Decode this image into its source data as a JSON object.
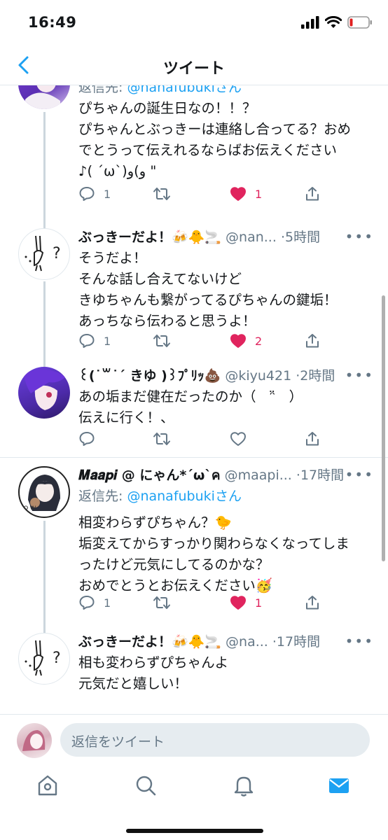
{
  "status_bar": {
    "time": "16:49"
  },
  "nav": {
    "title": "ツイート"
  },
  "tweets": [
    {
      "reply_prefix": "返信先: ",
      "reply_to": "@nanafubukiさん",
      "lines": [
        "ぴちゃんの誕生日なの！！？",
        "ぴちゃんとぶっきーは連絡し合ってる？おめ",
        "でとうって伝えれるならばお伝えください",
        "♪( ´ω`)و)و \""
      ],
      "replies": "1",
      "likes": "1",
      "liked": true
    },
    {
      "name": "ぶっきーだよ！🍻🐥🚬",
      "handle": "@nan...",
      "time": "·5時間",
      "lines": [
        "そうだよ！",
        "そんな話し合えてないけど",
        "きゆちゃんも繋がってるぴちゃんの鍵垢！",
        "あっちなら伝わると思うよ！"
      ],
      "replies": "1",
      "likes": "2",
      "liked": true
    },
    {
      "name": "꒰(˙꒳˙´ きゆ )꒱ﾌﾟﾘｯ💩",
      "handle": "@kiyu421",
      "time": "·2時間",
      "lines": [
        "あの垢まだ健在だったのか（　ᵔ̈　）",
        "伝えに行く！、"
      ],
      "replies": "",
      "likes": "",
      "liked": false
    },
    {
      "name": "𝑴𝒂𝒂𝒑𝒊 @ にゃん*´ω`ค",
      "handle": "@maapi...",
      "time": "·17時間",
      "reply_prefix": "返信先: ",
      "reply_to": "@nanafubukiさん",
      "lines": [
        "相変わらずぴちゃん？🐤",
        "垢変えてからすっかり関わらなくなってしま",
        "ったけど元気にしてるのかな？",
        "おめでとうとお伝えください🥳"
      ],
      "replies": "1",
      "likes": "1",
      "liked": true
    },
    {
      "name": "ぶっきーだよ！🍻🐥🚬",
      "handle": "@na...",
      "time": "·17時間",
      "lines": [
        "相も変わらずぴちゃんよ",
        "元気だと嬉しい！"
      ],
      "replies": "",
      "likes": "",
      "liked": false
    }
  ],
  "composer": {
    "placeholder": "返信をツイート"
  },
  "colors": {
    "accent": "#1da1f2",
    "like": "#e0245e",
    "muted": "#657786"
  },
  "icons": {
    "tabs": [
      "home-icon",
      "search-icon",
      "notifications-icon",
      "messages-icon"
    ],
    "actions": [
      "reply-icon",
      "retweet-icon",
      "like-icon",
      "share-icon"
    ]
  }
}
